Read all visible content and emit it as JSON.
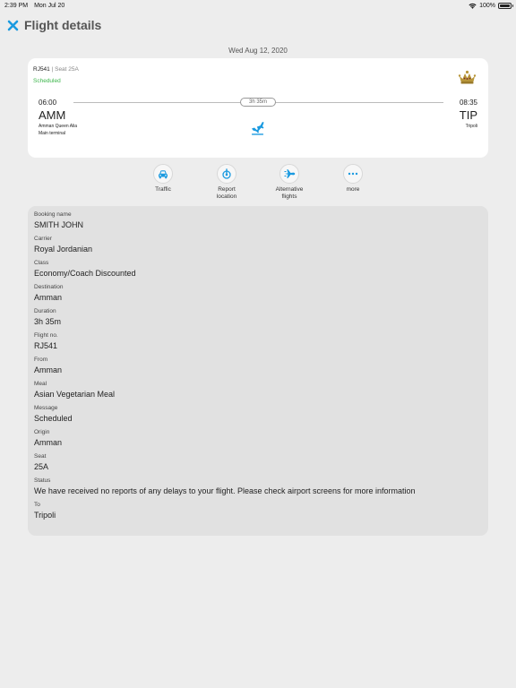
{
  "status_bar": {
    "time": "2:39 PM",
    "date": "Mon Jul 20",
    "battery": "100%"
  },
  "header": {
    "title": "Flight details"
  },
  "flight_date": "Wed Aug 12, 2020",
  "card": {
    "flight_number": "RJ541",
    "separator": " | ",
    "seat_label": "Seat 25A",
    "status": "Scheduled",
    "duration": "3h 35m",
    "departure": {
      "time": "06:00",
      "code": "AMM",
      "airport": "Amman Queen Alia",
      "terminal": "Main terminal"
    },
    "arrival": {
      "time": "08:35",
      "code": "TIP",
      "city": "Tripoli"
    },
    "airline_logo_icon": "crown-icon",
    "status_color": "#3bb54a",
    "accent_color": "#1a9ae0"
  },
  "actions": [
    {
      "label": "Traffic",
      "icon": "car-icon"
    },
    {
      "label": "Report\nlocation",
      "icon": "location-icon"
    },
    {
      "label": "Alternative\nflights",
      "icon": "plane-icon"
    },
    {
      "label": "more",
      "icon": "more-icon"
    }
  ],
  "details": [
    {
      "label": "Booking name",
      "value": "SMITH JOHN"
    },
    {
      "label": "Carrier",
      "value": "Royal Jordanian"
    },
    {
      "label": "Class",
      "value": "Economy/Coach Discounted"
    },
    {
      "label": "Destination",
      "value": "Amman"
    },
    {
      "label": "Duration",
      "value": "3h 35m"
    },
    {
      "label": "Flight no.",
      "value": "RJ541"
    },
    {
      "label": "From",
      "value": "Amman"
    },
    {
      "label": "Meal",
      "value": "Asian Vegetarian Meal"
    },
    {
      "label": "Message",
      "value": "Scheduled"
    },
    {
      "label": "Origin",
      "value": "Amman"
    },
    {
      "label": "Seat",
      "value": "25A"
    },
    {
      "label": "Status",
      "value": "We have received no reports of any delays to your flight. Please check airport screens for more information"
    },
    {
      "label": "To",
      "value": "Tripoli"
    }
  ]
}
